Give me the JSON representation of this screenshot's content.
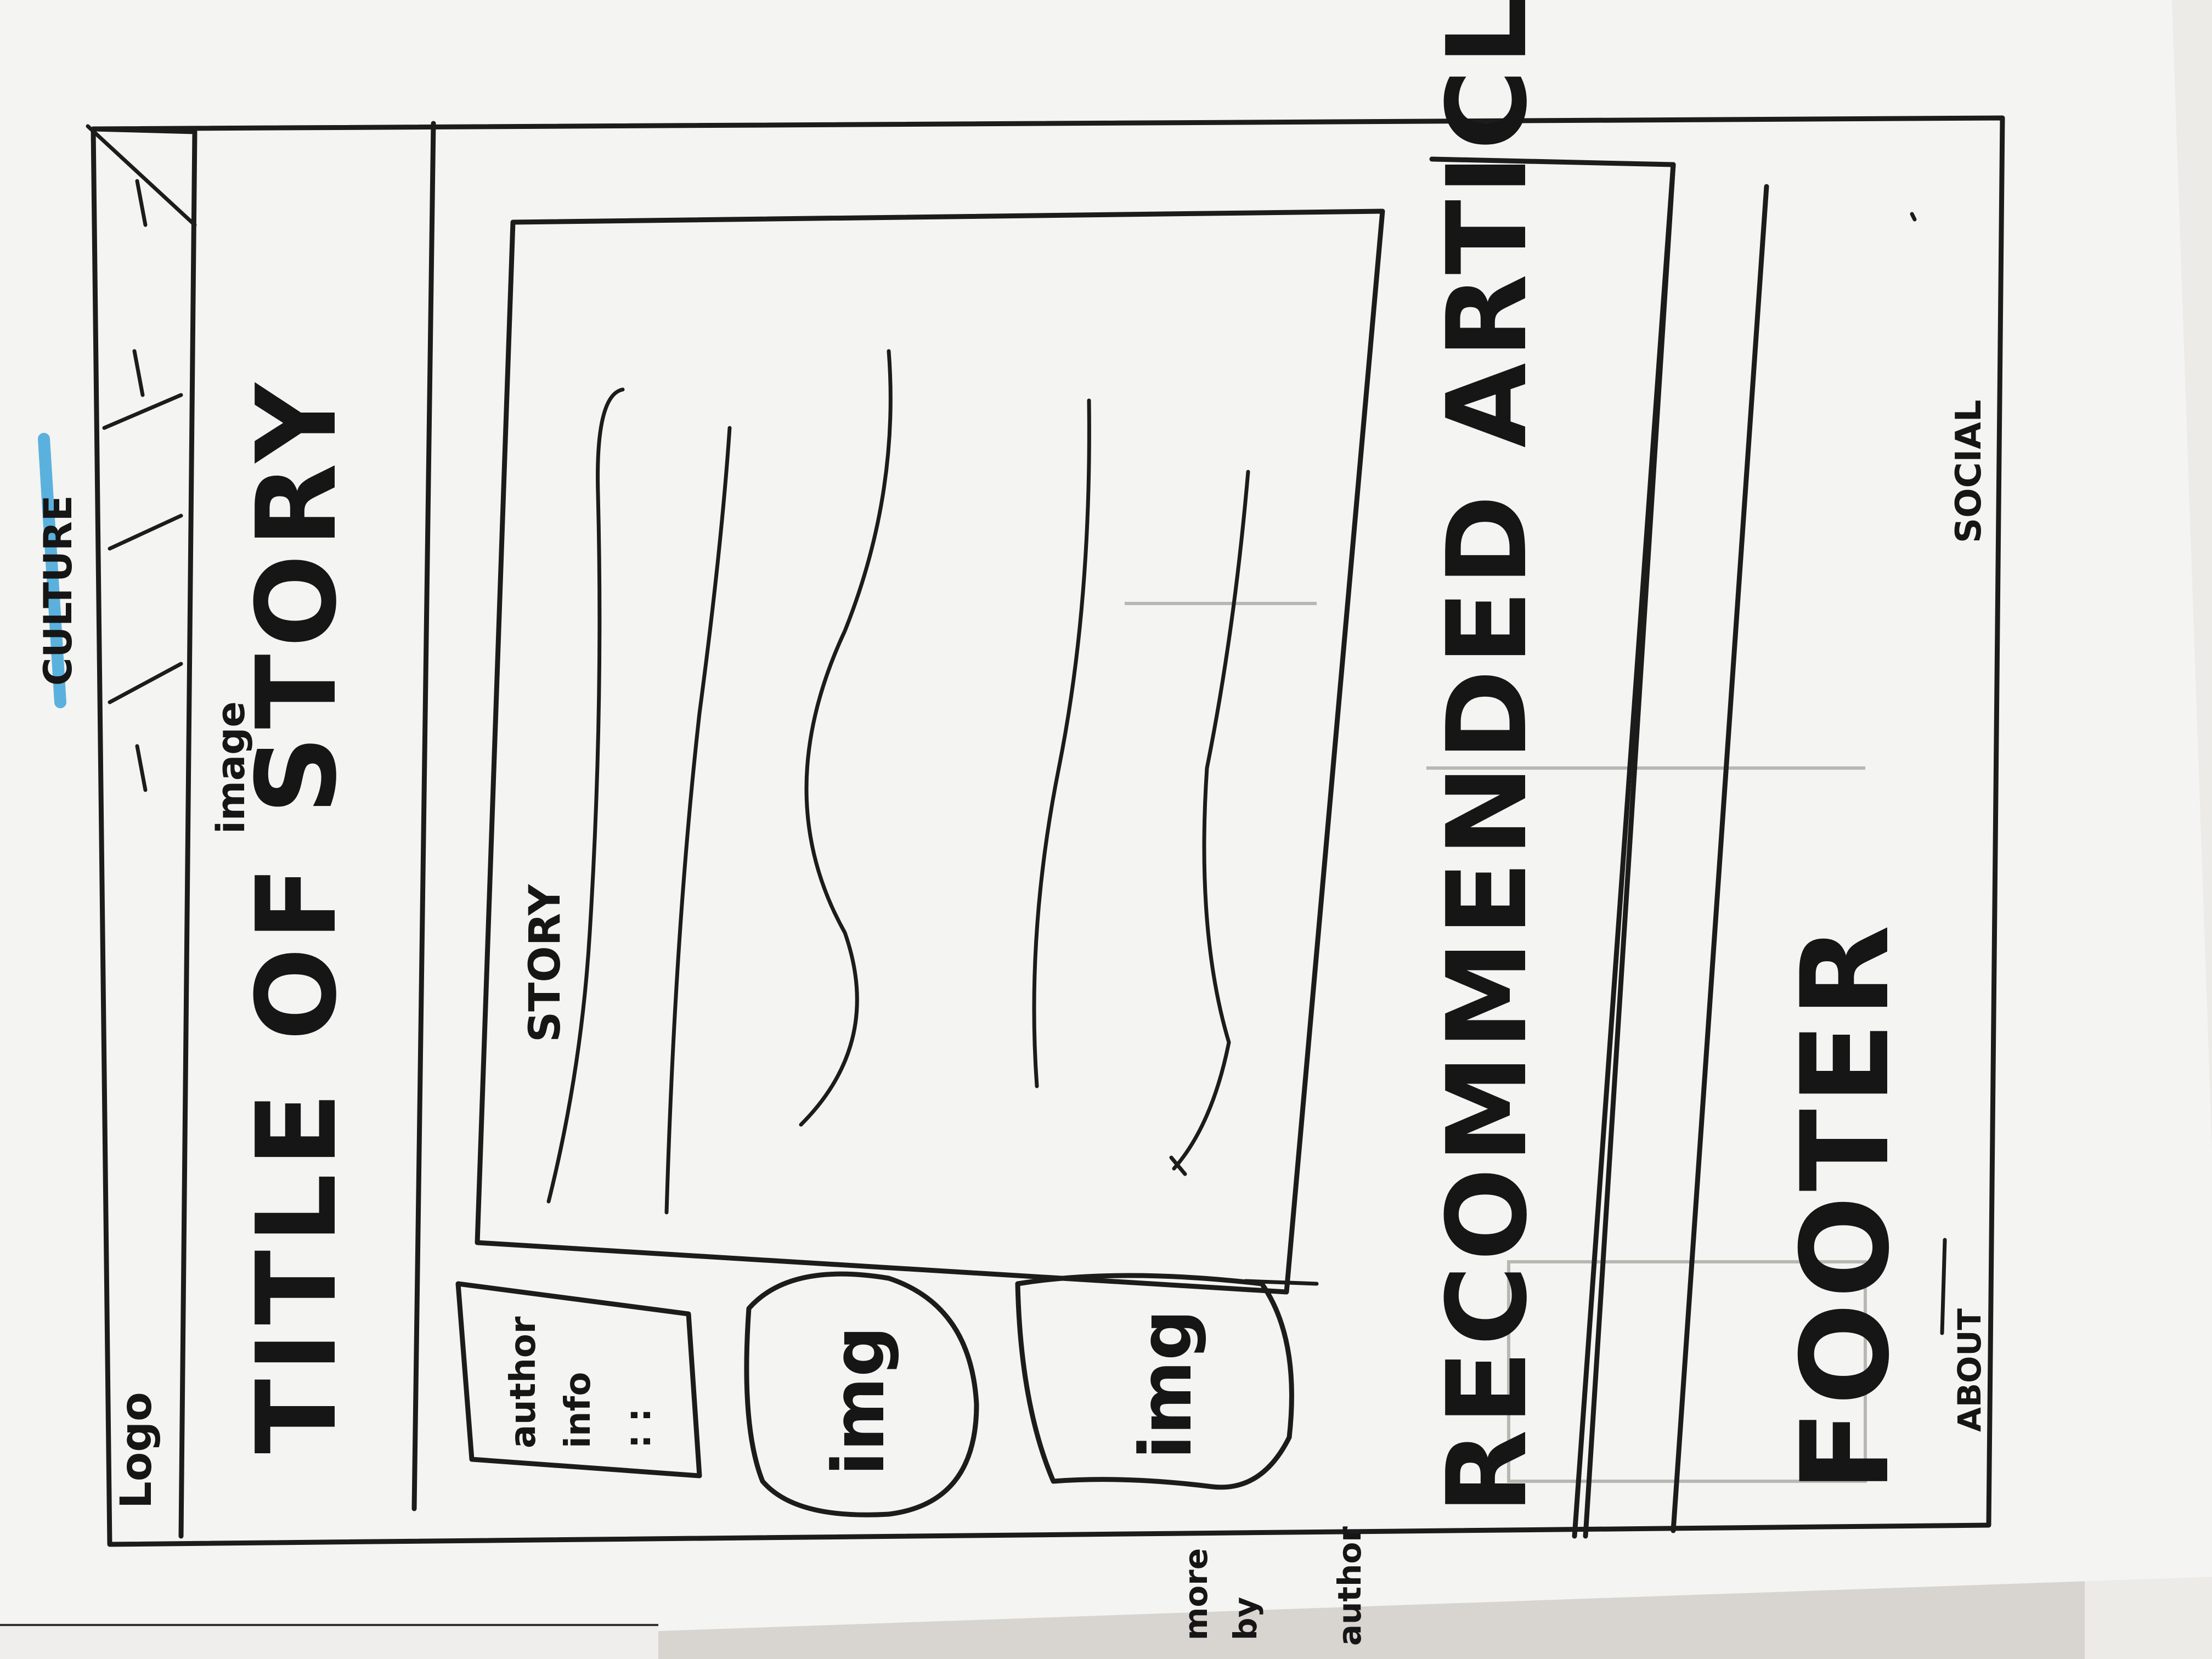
{
  "sketch": {
    "logo": "Logo",
    "culture_label": "CULTURE",
    "title": "TITLE OF STORY",
    "image_note": "image",
    "story_label": "STORY",
    "author_info": {
      "line1": "author",
      "line2": "info",
      "line3": ": :"
    },
    "img1": "img",
    "img2": "img",
    "more_by_author": {
      "line1": "more",
      "line2": "by",
      "line3": "author"
    },
    "recommended": "RECOMMENDED ARTICLES",
    "footer": "FOOTER",
    "about": "ABOUT",
    "social": "SOCIAL"
  },
  "colors": {
    "ink": "#1c1c1c",
    "highlighter": "#3fa5d9",
    "paper": "#f4f4f2"
  }
}
